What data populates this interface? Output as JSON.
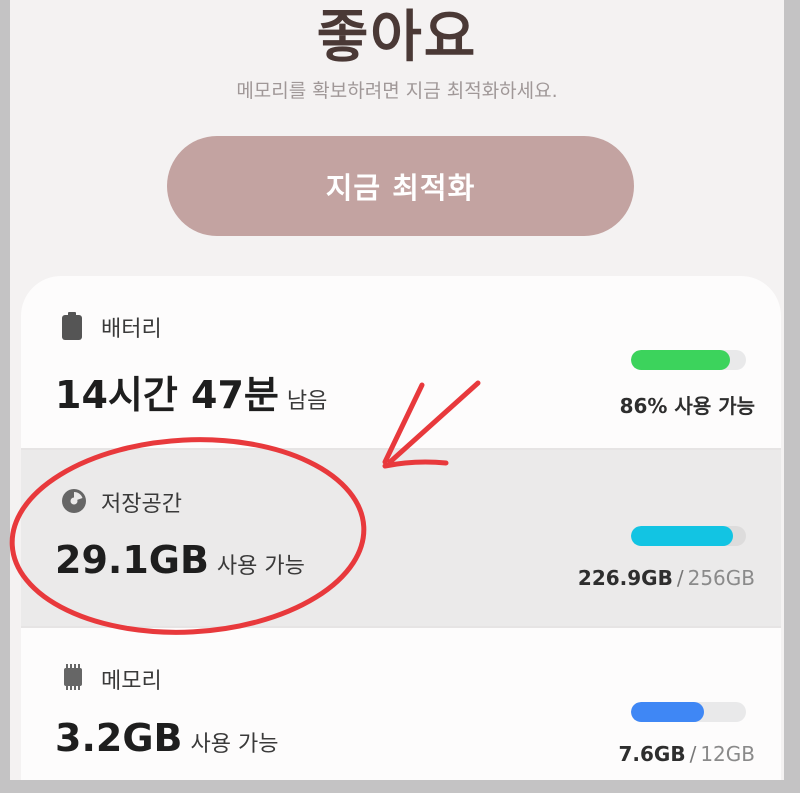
{
  "header": {
    "headline": "좋아요",
    "subtitle": "메모리를 확보하려면 지금 최적화하세요."
  },
  "optimize_button": {
    "label": "지금 최적화"
  },
  "colors": {
    "battery_bar": "#3cd35c",
    "storage_bar": "#12c4e3",
    "memory_bar": "#3f87f5",
    "annotation_red": "#e8393c"
  },
  "battery": {
    "title": "배터리",
    "icon": "battery-icon",
    "value": "14시간 47분",
    "value_suffix": "남음",
    "status": "86% 사용 가능",
    "level": 0.86
  },
  "storage": {
    "title": "저장공간",
    "icon": "pie-chart-icon",
    "value": "29.1GB",
    "value_suffix": "사용 가능",
    "used": "226.9GB",
    "separator": "/",
    "total": "256GB",
    "level": 0.886
  },
  "memory": {
    "title": "메모리",
    "icon": "memory-chip-icon",
    "value": "3.2GB",
    "value_suffix": "사용 가능",
    "used": "7.6GB",
    "separator": "/",
    "total": "12GB",
    "level": 0.633
  }
}
